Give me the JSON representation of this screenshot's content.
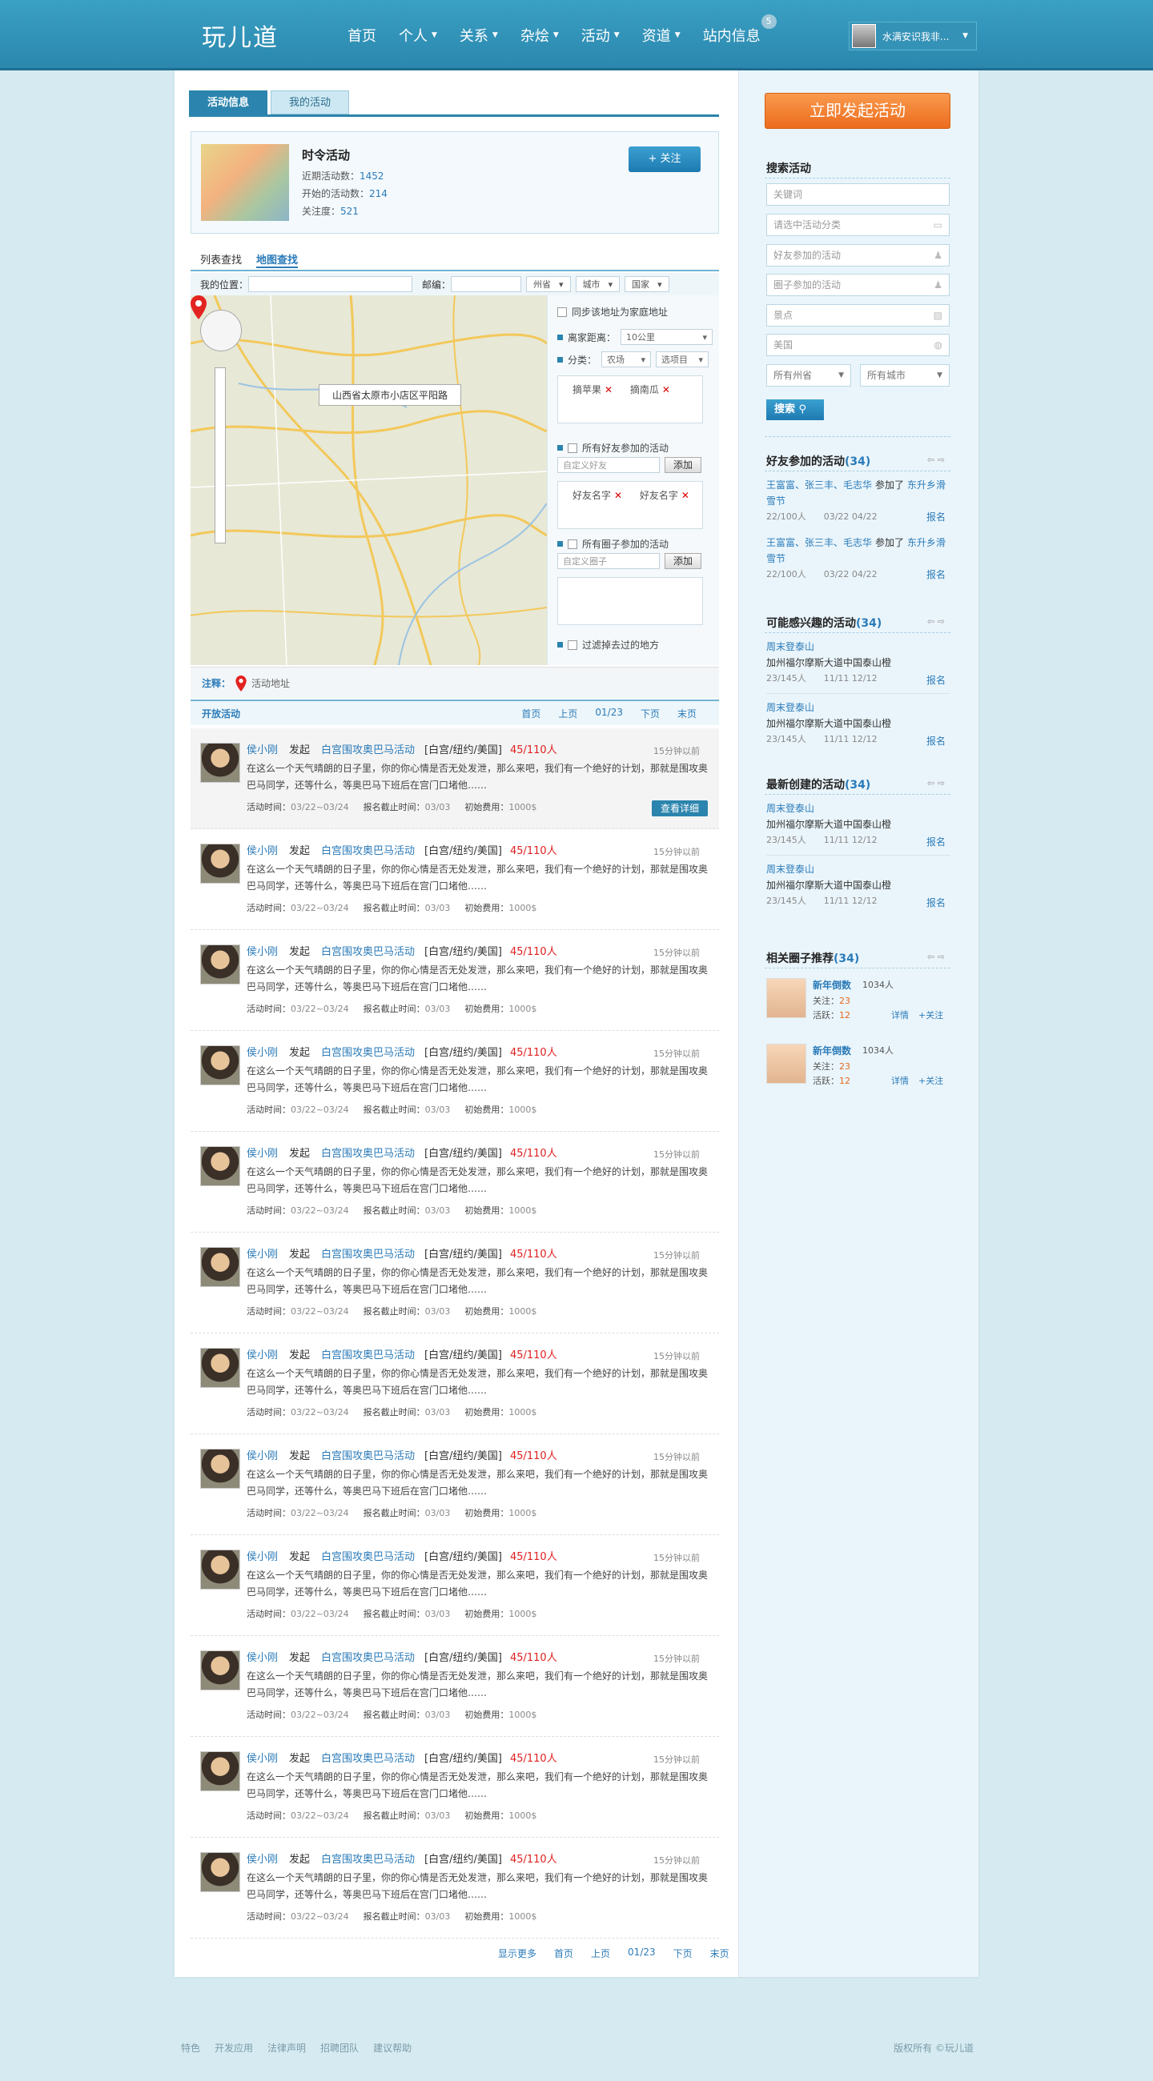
{
  "header": {
    "logo": "玩儿道",
    "nav": [
      {
        "label": "首页",
        "caret": false
      },
      {
        "label": "个人",
        "caret": true
      },
      {
        "label": "关系",
        "caret": true
      },
      {
        "label": "杂烩",
        "caret": true
      },
      {
        "label": "活动",
        "caret": true
      },
      {
        "label": "资道",
        "caret": true
      },
      {
        "label": "站内信息",
        "caret": false
      }
    ],
    "message_count": "5",
    "user_name": "水满安识我非..."
  },
  "tabs": {
    "active": "活动信息",
    "other": "我的活动"
  },
  "profile": {
    "title": "时令活动",
    "recent_label": "近期活动数：",
    "recent_value": "1452",
    "open_label": "开始的活动数：",
    "open_value": "214",
    "follow_label": "关注度：",
    "follow_value": "521",
    "follow_button": "+ 关注"
  },
  "view_switch": {
    "list": "列表查找",
    "map": "地图查找"
  },
  "location_bar": {
    "my_location": "我的位置：",
    "zip": "邮编：",
    "province": "州省",
    "city": "城市",
    "country": "国家"
  },
  "map": {
    "address_label": "山西省太原市小店区平阳路"
  },
  "filter": {
    "sync_home": "同步该地址为家庭地址",
    "distance_label": "离家距离：",
    "distance_value": "10公里",
    "category_label": "分类：",
    "category_value": "农场",
    "category_item": "选项目",
    "tags": [
      {
        "name": "摘苹果"
      },
      {
        "name": "摘南瓜"
      }
    ],
    "friends_label": "所有好友参加的活动",
    "friend_placeholder": "自定义好友",
    "add": "添加",
    "friend_tags": [
      {
        "name": "好友名字"
      },
      {
        "name": "好友名字"
      }
    ],
    "circle_label": "所有圈子参加的活动",
    "circle_placeholder": "自定义圈子",
    "filter_visited": "过滤掉去过的地方"
  },
  "legend": {
    "label": "注释：",
    "text": "活动地址"
  },
  "activities": {
    "title": "开放活动",
    "pagination": [
      "首页",
      "上页",
      "01/23",
      "下页",
      "末页"
    ],
    "bottom_pagination": [
      "显示更多",
      "首页",
      "上页",
      "01/23",
      "下页",
      "末页"
    ],
    "item": {
      "user": "侯小刚",
      "verb": "发起",
      "name": "白宫围攻奥巴马活动",
      "place": "[白宫/纽约/美国]",
      "count": "45/110人",
      "time": "15分钟以前",
      "desc": "在这么一个天气晴朗的日子里，你的你心情是否无处发泄，那么来吧，我们有一个绝好的计划，那就是围攻奥巴马同学，还等什么，等奥巴马下班后在宫门口堵他……",
      "time_label": "活动时间：",
      "time_value": "03/22~03/24",
      "deadline_label": "报名截止时间：",
      "deadline_value": "03/03",
      "fee_label": "初始费用：",
      "fee_value": "1000$",
      "detail": "查看详细"
    }
  },
  "sidebar": {
    "launch": "立即发起活动",
    "search_title": "搜索活动",
    "keyword": "关键词",
    "category": "请选中活动分类",
    "friends": "好友参加的活动",
    "circles": "圈子参加的活动",
    "place": "景点",
    "country": "美国",
    "province": "所有州省",
    "city": "所有城市",
    "search_btn": "搜索",
    "friends_title": "好友参加的活动",
    "friends_count": "(34)",
    "friend_acts": [
      {
        "names": "王富富、张三丰、毛志华",
        "joined": "参加了",
        "act": "东升乡滑雪节",
        "meta": "22/100人　　03/22 04/22",
        "sign": "报名"
      },
      {
        "names": "王富富、张三丰、毛志华",
        "joined": "参加了",
        "act": "东升乡滑雪节",
        "meta": "22/100人　　03/22 04/22",
        "sign": "报名"
      }
    ],
    "interest_title": "可能感兴趣的活动",
    "interest_count": "(34)",
    "interest": [
      {
        "t": "周末登泰山",
        "addr": "加州福尔摩斯大道中国泰山橙",
        "meta": "23/145人　　11/11 12/12",
        "sign": "报名"
      },
      {
        "t": "周末登泰山",
        "addr": "加州福尔摩斯大道中国泰山橙",
        "meta": "23/145人　　11/11 12/12",
        "sign": "报名"
      }
    ],
    "newest_title": "最新创建的活动",
    "newest_count": "(34)",
    "newest": [
      {
        "t": "周末登泰山",
        "addr": "加州福尔摩斯大道中国泰山橙",
        "meta": "23/145人　　11/11 12/12",
        "sign": "报名"
      },
      {
        "t": "周末登泰山",
        "addr": "加州福尔摩斯大道中国泰山橙",
        "meta": "23/145人　　11/11 12/12",
        "sign": "报名"
      }
    ],
    "groups_title": "相关圈子推荐",
    "groups_count": "(34)",
    "groups": [
      {
        "name": "新年倒数",
        "count": "1034人",
        "follow": "关注：",
        "follow_v": "23",
        "active": "活跃：",
        "active_v": "12",
        "detail": "详情",
        "add": "+关注"
      },
      {
        "name": "新年倒数",
        "count": "1034人",
        "follow": "关注：",
        "follow_v": "23",
        "active": "活跃：",
        "active_v": "12",
        "detail": "详情",
        "add": "+关注"
      }
    ]
  },
  "footer": {
    "links": [
      "特色",
      "开发应用",
      "法律声明",
      "招聘团队",
      "建议帮助"
    ],
    "copyright": "版权所有 ©玩儿道"
  }
}
